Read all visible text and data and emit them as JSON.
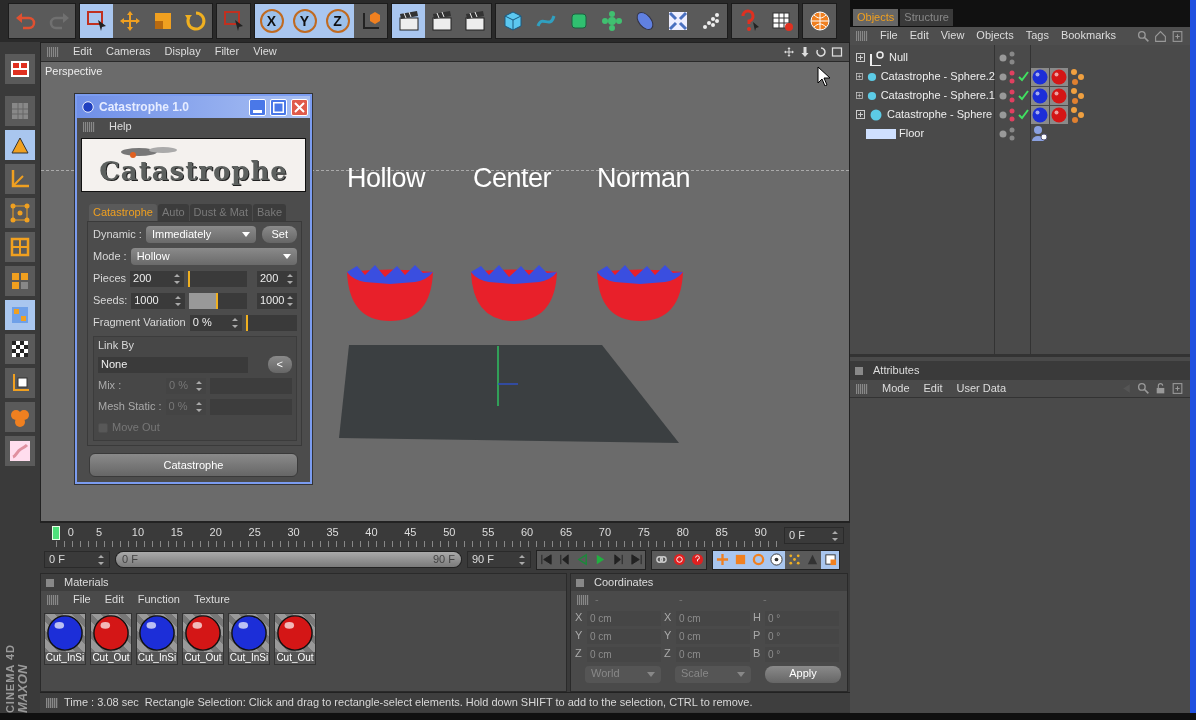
{
  "toolbar": [
    [
      {
        "kind": "undo",
        "selected": false,
        "disabled": false
      },
      {
        "kind": "redo",
        "selected": false,
        "disabled": true
      }
    ],
    [
      {
        "kind": "select",
        "selected": true,
        "disabled": false
      },
      {
        "kind": "move",
        "selected": false,
        "disabled": false
      },
      {
        "kind": "scale",
        "selected": false,
        "disabled": false
      },
      {
        "kind": "rotate",
        "selected": false,
        "disabled": false
      }
    ],
    [
      {
        "kind": "select",
        "selected": false,
        "disabled": false
      }
    ],
    [
      {
        "kind": "axis",
        "label": "X",
        "selected": true,
        "disabled": false
      },
      {
        "kind": "axis",
        "label": "Y",
        "selected": true,
        "disabled": false
      },
      {
        "kind": "axis",
        "label": "Z",
        "selected": true,
        "disabled": false
      },
      {
        "kind": "coords",
        "selected": false,
        "disabled": false
      }
    ],
    [
      {
        "kind": "clapper",
        "selected": true,
        "disabled": false
      },
      {
        "kind": "clapper",
        "selected": false,
        "disabled": false
      },
      {
        "kind": "clapper",
        "selected": false,
        "disabled": false
      }
    ],
    [
      {
        "kind": "cube",
        "selected": false,
        "disabled": false
      },
      {
        "kind": "spline",
        "selected": false,
        "disabled": false
      },
      {
        "kind": "nurbs",
        "selected": false,
        "disabled": false
      },
      {
        "kind": "array",
        "selected": false,
        "disabled": false
      },
      {
        "kind": "deformer",
        "selected": false,
        "disabled": false
      },
      {
        "kind": "scene",
        "selected": false,
        "disabled": false
      },
      {
        "kind": "particles",
        "selected": false,
        "disabled": false
      }
    ],
    [
      {
        "kind": "help",
        "selected": false,
        "disabled": false
      },
      {
        "kind": "table",
        "selected": false,
        "disabled": false
      }
    ],
    [
      {
        "kind": "globe",
        "selected": false,
        "disabled": false
      }
    ]
  ],
  "side_tools": [
    {
      "kind": "layout",
      "selected": false
    },
    {
      "kind": "camera",
      "selected": false
    },
    {
      "kind": "model",
      "selected": true
    },
    {
      "kind": "axes",
      "selected": false
    },
    {
      "kind": "points",
      "selected": false
    },
    {
      "kind": "edges",
      "selected": false
    },
    {
      "kind": "polygons",
      "selected": false
    },
    {
      "kind": "texture",
      "selected": true
    },
    {
      "kind": "checker",
      "selected": false
    },
    {
      "kind": "workplane",
      "selected": false
    },
    {
      "kind": "spheres",
      "selected": false
    },
    {
      "kind": "paint",
      "selected": false
    }
  ],
  "brand": [
    "MAXON",
    "CINEMA 4D"
  ],
  "viewport": {
    "menu": [
      "Edit",
      "Cameras",
      "Display",
      "Filter",
      "View"
    ],
    "name": "Perspective",
    "objects": [
      {
        "label": "Hollow"
      },
      {
        "label": "Center"
      },
      {
        "label": "Norman"
      }
    ]
  },
  "dialog": {
    "title": "Catastrophe 1.0",
    "menu": [
      "Help"
    ],
    "banner_text": "Catastrophe",
    "tabs": [
      {
        "label": "Catastrophe",
        "selected": true
      },
      {
        "label": "Auto",
        "selected": false
      },
      {
        "label": "Dust & Mat",
        "selected": false
      },
      {
        "label": "Bake",
        "selected": false
      }
    ],
    "params": [
      {
        "kind": "dropdown",
        "label": "Dynamic :",
        "value": "Immediately",
        "button": "Set"
      },
      {
        "kind": "dropdown",
        "label": "Mode :",
        "value": "Hollow"
      },
      {
        "kind": "slider",
        "label": "Pieces",
        "value": "200",
        "level": 0.02,
        "max_value": "200"
      },
      {
        "kind": "slider",
        "label": "Seeds:",
        "value": "1000",
        "level": 0.5,
        "max_value": "1000"
      },
      {
        "kind": "slider",
        "label": "Fragment Variation",
        "value": "0 %",
        "level": 0
      }
    ],
    "link_by": {
      "title": "Link By",
      "value": "None",
      "button": "<",
      "rows": [
        {
          "label": "Mix :",
          "value": "0 %",
          "disabled": true
        },
        {
          "label": "Mesh Static :",
          "value": "0 %",
          "disabled": true
        }
      ],
      "checkbox": {
        "label": "Move Out",
        "checked": false,
        "disabled": true
      }
    },
    "action": "Catastrophe"
  },
  "timeline": {
    "ticks": [
      "0",
      "5",
      "10",
      "15",
      "20",
      "25",
      "30",
      "35",
      "40",
      "45",
      "50",
      "55",
      "60",
      "65",
      "70",
      "75",
      "80",
      "85",
      "90"
    ],
    "level": 0,
    "current": "0 F",
    "start": "0 F",
    "range": {
      "start": "0 F",
      "end": "90 F",
      "level": 1
    },
    "end": "90 F",
    "transport": [
      {
        "kind": "first",
        "selected": false
      },
      {
        "kind": "prevkey",
        "selected": false
      },
      {
        "kind": "playback",
        "selected": false
      },
      {
        "kind": "play",
        "selected": false
      },
      {
        "kind": "nextkey",
        "selected": false
      },
      {
        "kind": "last",
        "selected": false
      }
    ],
    "record": [
      {
        "kind": "link",
        "selected": false
      },
      {
        "kind": "record",
        "selected": false
      },
      {
        "kind": "autokey",
        "selected": false
      }
    ],
    "keys": [
      {
        "kind": "pos",
        "selected": true
      },
      {
        "kind": "size",
        "selected": true
      },
      {
        "kind": "rot",
        "selected": true
      },
      {
        "kind": "param",
        "selected": true
      },
      {
        "kind": "points",
        "selected": false
      },
      {
        "kind": "pla",
        "selected": false
      },
      {
        "kind": "keyset",
        "selected": true
      }
    ]
  },
  "materials": {
    "title": "Materials",
    "menu": [
      "File",
      "Edit",
      "Function",
      "Texture"
    ],
    "items": [
      {
        "label": "Cut_InSi",
        "color": "#1c2ed8"
      },
      {
        "label": "Cut_Out",
        "color": "#d41616"
      },
      {
        "label": "Cut_InSi",
        "color": "#1c2ed8"
      },
      {
        "label": "Cut_Out",
        "color": "#d41616"
      },
      {
        "label": "Cut_InSi",
        "color": "#1c2ed8"
      },
      {
        "label": "Cut_Out",
        "color": "#d41616"
      }
    ]
  },
  "coordinates": {
    "title": "Coordinates",
    "columns": [
      "-",
      "-",
      "-"
    ],
    "rows": [
      [
        {
          "axis": "X",
          "value": "0 cm"
        },
        {
          "axis": "X",
          "value": "0 cm"
        },
        {
          "axis": "H",
          "value": "0 °"
        }
      ],
      [
        {
          "axis": "Y",
          "value": "0 cm"
        },
        {
          "axis": "Y",
          "value": "0 cm"
        },
        {
          "axis": "P",
          "value": "0 °"
        }
      ],
      [
        {
          "axis": "Z",
          "value": "0 cm"
        },
        {
          "axis": "Z",
          "value": "0 cm"
        },
        {
          "axis": "B",
          "value": "0 °"
        }
      ]
    ],
    "dropdowns": [
      "World",
      "Scale"
    ],
    "button": "Apply"
  },
  "status": {
    "time": "Time : 3.08 sec",
    "message": "Rectangle Selection: Click and drag to rectangle-select elements. Hold down SHIFT to add to the selection, CTRL to remove."
  },
  "objects": {
    "tabs": [
      {
        "label": "Objects",
        "selected": true
      },
      {
        "label": "Structure",
        "selected": false
      }
    ],
    "menu": [
      "File",
      "Edit",
      "View",
      "Objects",
      "Tags",
      "Bookmarks"
    ],
    "tree": [
      {
        "name": "Null",
        "kind": "null",
        "expanded": false,
        "hidden": false,
        "check": false
      },
      {
        "name": "Catastrophe - Sphere.2",
        "kind": "sphere",
        "expanded": false,
        "hidden": true,
        "check": true,
        "tags": [
          {
            "kind": "material",
            "color": "#1c2ed8"
          },
          {
            "kind": "material",
            "color": "#d41616"
          },
          {
            "kind": "dynamics"
          }
        ]
      },
      {
        "name": "Catastrophe - Sphere.1",
        "kind": "sphere",
        "expanded": false,
        "hidden": true,
        "check": true,
        "tags": [
          {
            "kind": "material",
            "color": "#1c2ed8"
          },
          {
            "kind": "material",
            "color": "#d41616"
          },
          {
            "kind": "dynamics"
          }
        ]
      },
      {
        "name": "Catastrophe - Sphere",
        "kind": "sphere",
        "expanded": false,
        "hidden": true,
        "check": true,
        "tags": [
          {
            "kind": "material",
            "color": "#1c2ed8"
          },
          {
            "kind": "material",
            "color": "#d41616"
          },
          {
            "kind": "dynamics"
          }
        ]
      },
      {
        "name": "Floor",
        "kind": "floor",
        "hidden": false,
        "check": false,
        "tags": [
          {
            "kind": "compositing"
          }
        ]
      }
    ]
  },
  "attributes": {
    "title": "Attributes",
    "menu": [
      "Mode",
      "Edit",
      "User Data"
    ]
  }
}
